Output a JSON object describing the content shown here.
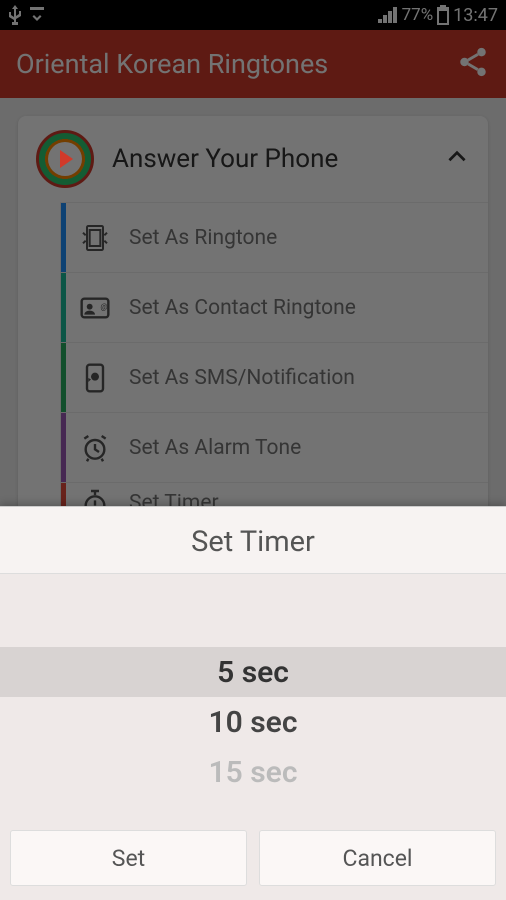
{
  "status": {
    "battery_pct": "77%",
    "time": "13:47"
  },
  "appbar": {
    "title": "Oriental Korean Ringtones"
  },
  "track": {
    "title": "Answer Your Phone"
  },
  "options": [
    {
      "label": "Set As Ringtone",
      "color": "#1e90ff"
    },
    {
      "label": "Set As Contact Ringtone",
      "color": "#1abc9c"
    },
    {
      "label": "Set As SMS/Notification",
      "color": "#27ae60"
    },
    {
      "label": "Set As Alarm Tone",
      "color": "#9b59b6"
    },
    {
      "label": "Set Timer",
      "color": "#e74c3c"
    }
  ],
  "dialog": {
    "title": "Set Timer",
    "picker": {
      "selected": "5 sec",
      "next": "10 sec",
      "after": "15 sec"
    },
    "buttons": {
      "set": "Set",
      "cancel": "Cancel"
    }
  }
}
